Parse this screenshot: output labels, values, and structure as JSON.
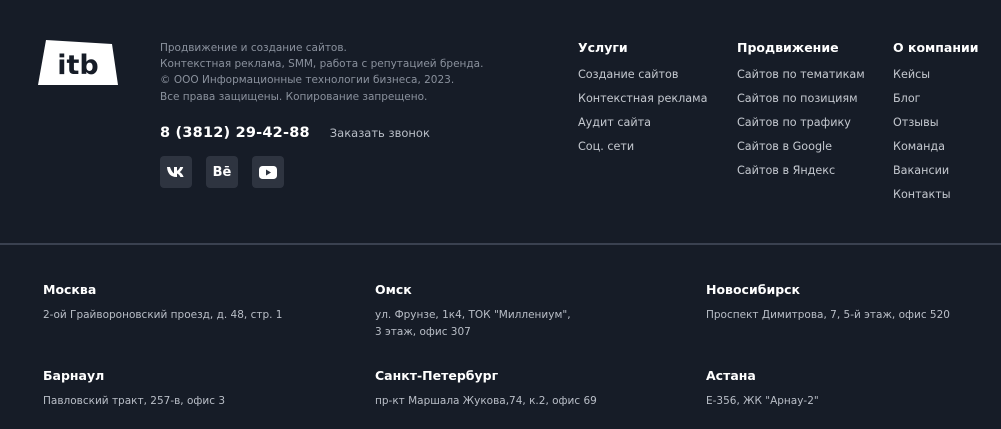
{
  "brand": {
    "logo_text": "itb"
  },
  "about": {
    "lines": [
      "Продвижение и создание сайтов.",
      "Контекстная реклама, SMM, работа с репутацией бренда.",
      "© ООО Информационные технологии бизнеса, 2023.",
      "Все права защищены. Копирование запрещено."
    ]
  },
  "contact": {
    "phone": "8 (3812) 29-42-88",
    "callback_label": "Заказать звонок"
  },
  "socials": [
    {
      "icon": "vk-icon",
      "label": "VK"
    },
    {
      "icon": "behance-icon",
      "label": "Bē"
    },
    {
      "icon": "youtube-icon",
      "label": ""
    }
  ],
  "nav": {
    "services": {
      "title": "Услуги",
      "items": [
        "Создание сайтов",
        "Контекстная реклама",
        "Аудит сайта",
        "Соц. сети"
      ]
    },
    "promotion": {
      "title": "Продвижение",
      "items": [
        "Сайтов по тематикам",
        "Сайтов по позициям",
        "Сайтов по трафику",
        "Сайтов в Google",
        "Сайтов в Яндекс"
      ]
    },
    "company": {
      "title": "О компании",
      "items": [
        "Кейсы",
        "Блог",
        "Отзывы",
        "Команда",
        "Вакансии",
        "Контакты"
      ]
    }
  },
  "offices": [
    {
      "city": "Москва",
      "address": [
        "2-ой Грайвороновский проезд, д. 48, стр. 1"
      ]
    },
    {
      "city": "Омск",
      "address": [
        "ул. Фрунзе, 1к4, ТОК \"Миллениум\",",
        "3 этаж, офис 307"
      ]
    },
    {
      "city": "Новосибирск",
      "address": [
        "Проспект Димитрова, 7, 5-й этаж, офис 520"
      ]
    },
    {
      "city": "Барнаул",
      "address": [
        "Павловский тракт, 257-в, офис 3"
      ]
    },
    {
      "city": "Санкт-Петербург",
      "address": [
        "пр-кт Маршала Жукова,74, к.2, офис 69"
      ]
    },
    {
      "city": "Астана",
      "address": [
        "Е-356, ЖК \"Арнау-2\""
      ]
    }
  ],
  "colors": {
    "background": "#161c27",
    "text": "#ffffff",
    "muted": "#8a919d",
    "social_bg": "#2e3440"
  }
}
